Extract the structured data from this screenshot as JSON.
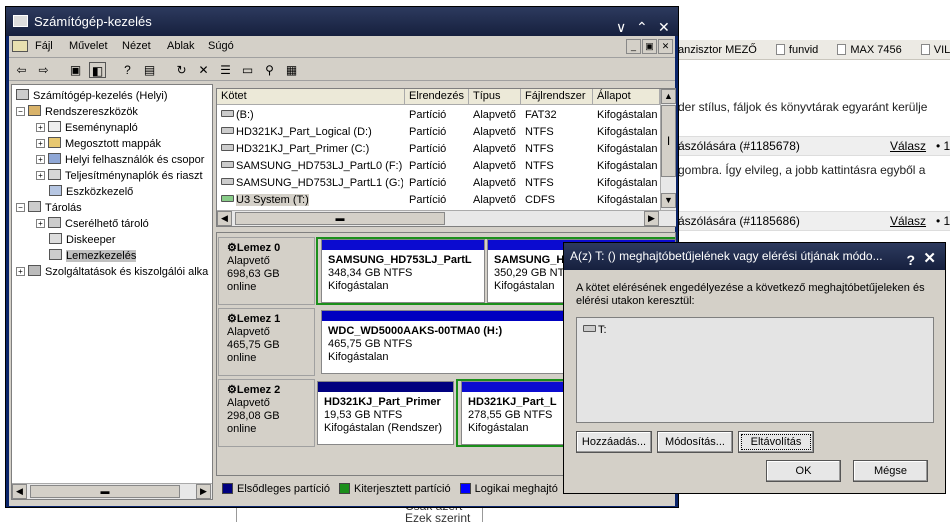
{
  "browser": {
    "bookmarks": [
      "anzisztor MEZŐ",
      "funvid",
      "MAX 7456",
      "VILÁG V"
    ],
    "text1": "der stílus, fáljok és könyvtárak egyaránt kerülje",
    "reply1_head": "ászólására (#1185678)",
    "reply_label": "Válasz",
    "bullet_tail": "• 1",
    "text2": "gombra. Így elvileg, a jobb kattintásra egyből a",
    "reply2_head": "ászólására (#1185686)",
    "bottom_line1": "Csak azért",
    "bottom_line2": "Ezek szerint"
  },
  "window": {
    "title": "Számítógép-kezelés",
    "menu": [
      "Fájl",
      "Művelet",
      "Nézet",
      "Ablak",
      "Súgó"
    ]
  },
  "tree": {
    "root": "Számítógép-kezelés (Helyi)",
    "system_tools": "Rendszereszközök",
    "event_viewer": "Eseménynapló",
    "shared_folders": "Megosztott mappák",
    "local_users": "Helyi felhasználók és csopor",
    "perf_logs": "Teljesítménynaplók és riaszt",
    "device_manager": "Eszközkezelő",
    "storage": "Tárolás",
    "removable": "Cserélhető tároló",
    "defrag": "Diskeeper",
    "disk_mgmt": "Lemezkezelés",
    "services": "Szolgáltatások és kiszolgálói alka"
  },
  "volumes": {
    "headers": [
      "Kötet",
      "Elrendezés",
      "Típus",
      "Fájlrendszer",
      "Állapot"
    ],
    "rows": [
      {
        "name": "(B:)",
        "layout": "Partíció",
        "type": "Alapvető",
        "fs": "FAT32",
        "status": "Kifogástalan"
      },
      {
        "name": "HD321KJ_Part_Logical (D:)",
        "layout": "Partíció",
        "type": "Alapvető",
        "fs": "NTFS",
        "status": "Kifogástalan"
      },
      {
        "name": "HD321KJ_Part_Primer (C:)",
        "layout": "Partíció",
        "type": "Alapvető",
        "fs": "NTFS",
        "status": "Kifogástalan"
      },
      {
        "name": "SAMSUNG_HD753LJ_PartL0 (F:)",
        "layout": "Partíció",
        "type": "Alapvető",
        "fs": "NTFS",
        "status": "Kifogástalan"
      },
      {
        "name": "SAMSUNG_HD753LJ_PartL1 (G:)",
        "layout": "Partíció",
        "type": "Alapvető",
        "fs": "NTFS",
        "status": "Kifogástalan"
      },
      {
        "name": "U3 System (T:)",
        "layout": "Partíció",
        "type": "Alapvető",
        "fs": "CDFS",
        "status": "Kifogástalan"
      }
    ]
  },
  "disks": [
    {
      "name": "Lemez 0",
      "type": "Alapvető",
      "size": "698,63 GB",
      "state": "online",
      "parts": [
        {
          "label": "SAMSUNG_HD753LJ_PartL",
          "size": "348,34 GB NTFS",
          "status": "Kifogástalan"
        },
        {
          "label": "SAMSUNG_H",
          "size": "350,29 GB NTFS",
          "status": "Kifogástalan"
        }
      ]
    },
    {
      "name": "Lemez 1",
      "type": "Alapvető",
      "size": "465,75 GB",
      "state": "online",
      "parts": [
        {
          "label": "WDC_WD5000AAKS-00TMA0  (H:)",
          "size": "465,75 GB NTFS",
          "status": "Kifogástalan"
        }
      ]
    },
    {
      "name": "Lemez 2",
      "type": "Alapvető",
      "size": "298,08 GB",
      "state": "online",
      "parts": [
        {
          "label": "HD321KJ_Part_Primer",
          "size": "19,53 GB NTFS",
          "status": "Kifogástalan (Rendszer)"
        },
        {
          "label": "HD321KJ_Part_L",
          "size": "278,55 GB NTFS",
          "status": "Kifogástalan"
        }
      ]
    }
  ],
  "legend": [
    {
      "label": "Elsődleges partíció",
      "color": "#00007f"
    },
    {
      "label": "Kiterjesztett partíció",
      "color": "#1b8f1b"
    },
    {
      "label": "Logikai meghajtó",
      "color": "#0000ff"
    }
  ],
  "dialog": {
    "title": "A(z) T: () meghajtóbetűjelének vagy elérési útjának módo...",
    "message": "A kötet elérésének engedélyezése a következő meghajtóbetűjeleken és elérési utakon keresztül:",
    "item": "T:",
    "add": "Hozzáadás...",
    "modify": "Módosítás...",
    "remove": "Eltávolítás",
    "ok": "OK",
    "cancel": "Mégse"
  }
}
